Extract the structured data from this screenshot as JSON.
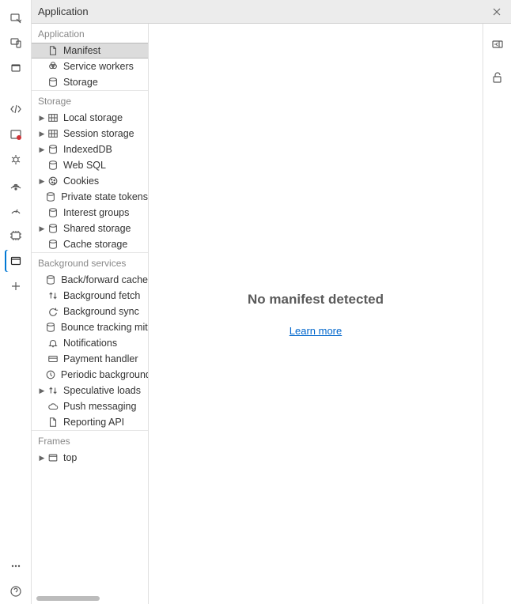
{
  "titlebar": {
    "title": "Application"
  },
  "sections": {
    "application": {
      "label": "Application",
      "items": [
        {
          "label": "Manifest",
          "icon": "file",
          "selected": true
        },
        {
          "label": "Service workers",
          "icon": "service-worker"
        },
        {
          "label": "Storage",
          "icon": "database"
        }
      ]
    },
    "storage": {
      "label": "Storage",
      "items": [
        {
          "label": "Local storage",
          "icon": "grid",
          "expandable": true
        },
        {
          "label": "Session storage",
          "icon": "grid",
          "expandable": true
        },
        {
          "label": "IndexedDB",
          "icon": "database",
          "expandable": true
        },
        {
          "label": "Web SQL",
          "icon": "database"
        },
        {
          "label": "Cookies",
          "icon": "cookie",
          "expandable": true
        },
        {
          "label": "Private state tokens",
          "icon": "database"
        },
        {
          "label": "Interest groups",
          "icon": "database"
        },
        {
          "label": "Shared storage",
          "icon": "database",
          "expandable": true
        },
        {
          "label": "Cache storage",
          "icon": "database"
        }
      ]
    },
    "background": {
      "label": "Background services",
      "items": [
        {
          "label": "Back/forward cache",
          "icon": "database"
        },
        {
          "label": "Background fetch",
          "icon": "updown"
        },
        {
          "label": "Background sync",
          "icon": "sync"
        },
        {
          "label": "Bounce tracking mitigations",
          "icon": "database"
        },
        {
          "label": "Notifications",
          "icon": "bell"
        },
        {
          "label": "Payment handler",
          "icon": "card"
        },
        {
          "label": "Periodic background sync",
          "icon": "clock"
        },
        {
          "label": "Speculative loads",
          "icon": "updown",
          "expandable": true
        },
        {
          "label": "Push messaging",
          "icon": "cloud"
        },
        {
          "label": "Reporting API",
          "icon": "file"
        }
      ]
    },
    "frames": {
      "label": "Frames",
      "items": [
        {
          "label": "top",
          "icon": "frame",
          "expandable": true
        }
      ]
    }
  },
  "content": {
    "heading": "No manifest detected",
    "link_label": "Learn more"
  }
}
